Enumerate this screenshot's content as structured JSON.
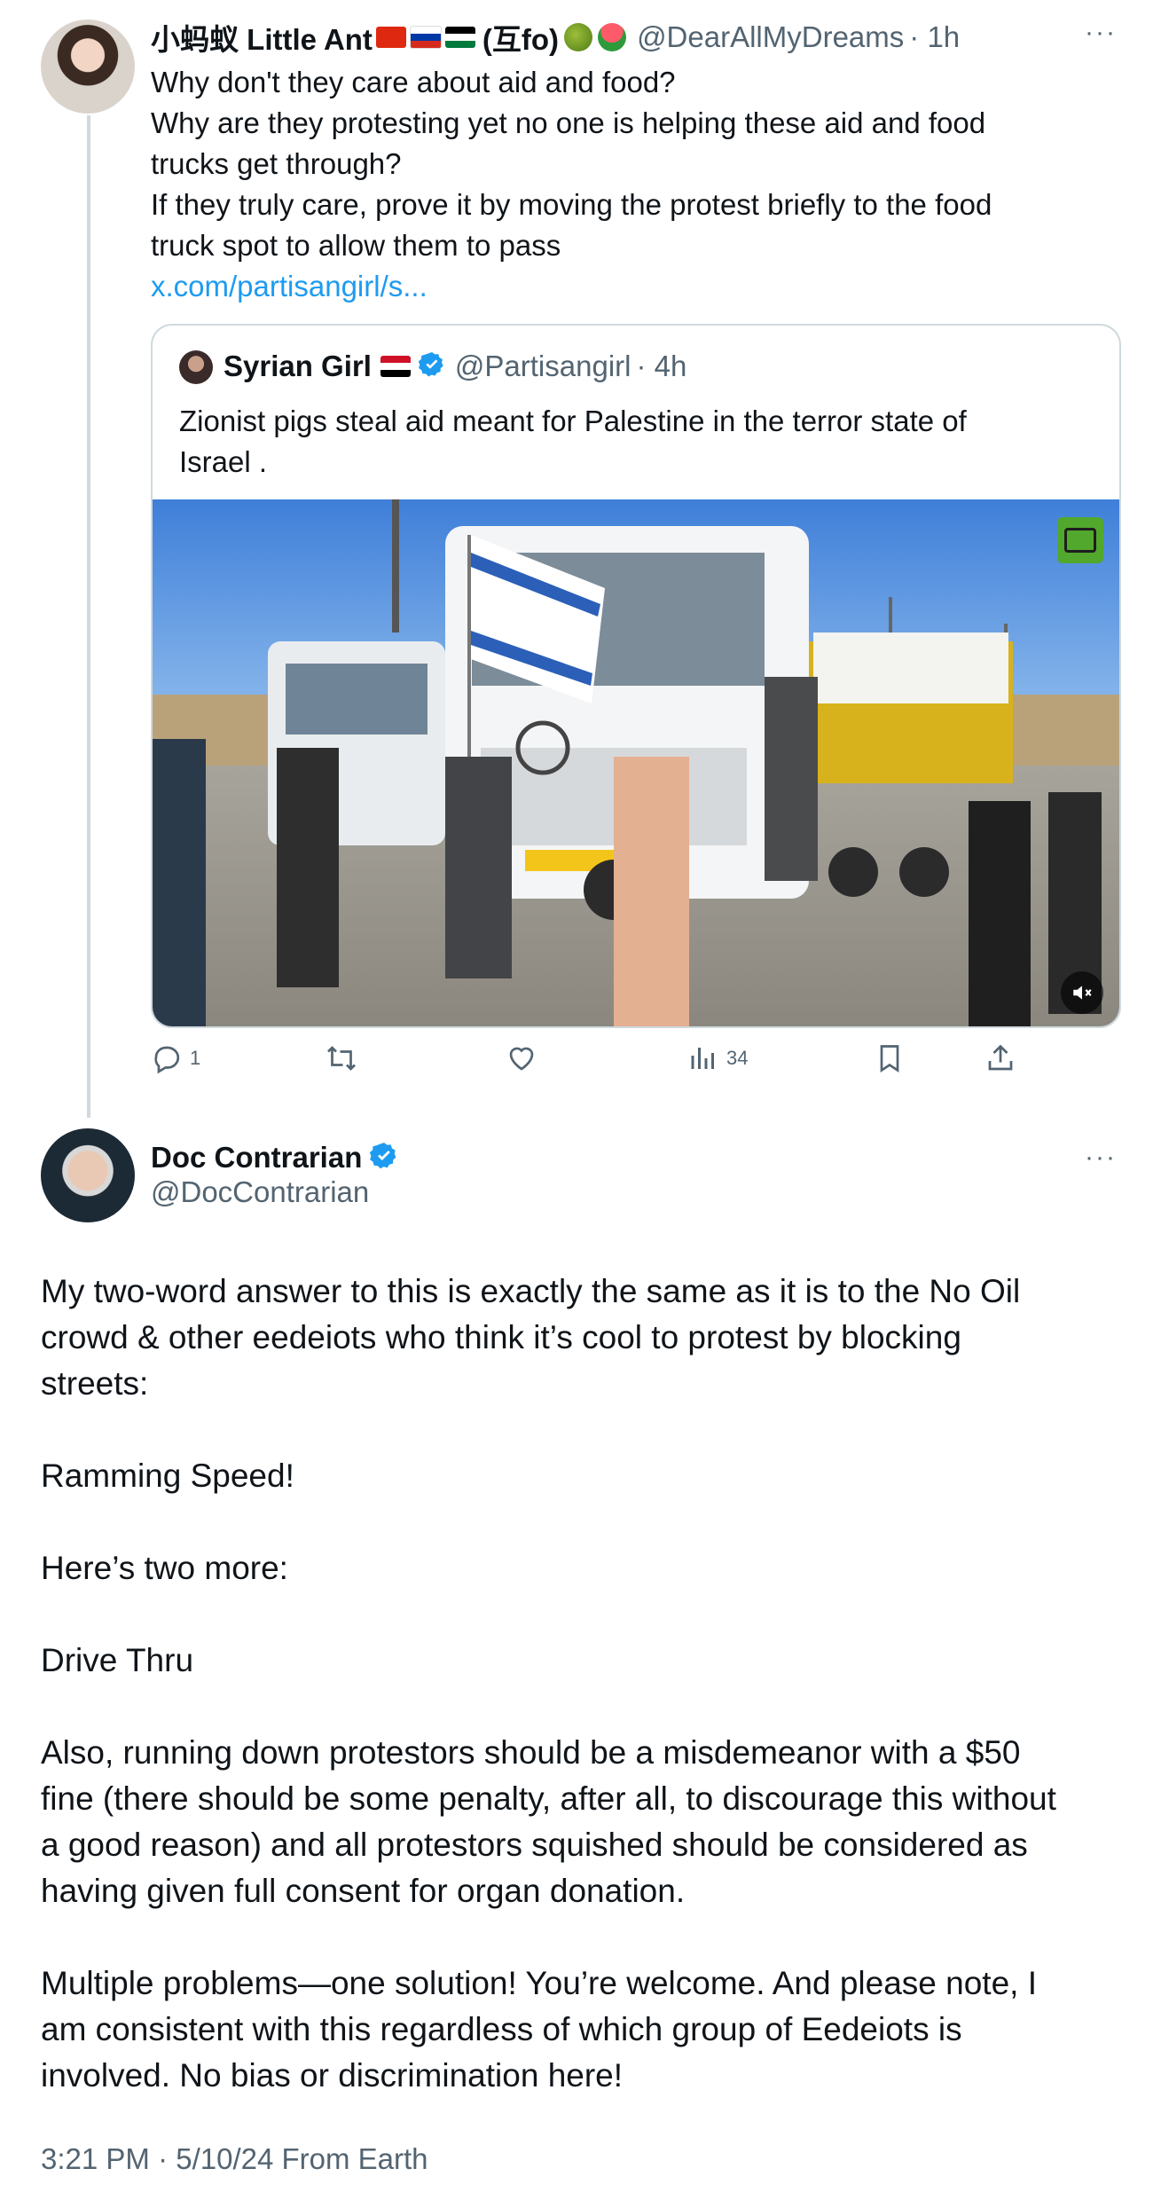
{
  "parent_tweet": {
    "display_name": "小蚂蚁 Little Ant",
    "name_suffix": "(互fo)",
    "handle": "@DearAllMyDreams",
    "time": "· 1h",
    "more": "···",
    "lines": [
      "Why don't they care about aid and food?",
      "Why are they protesting yet no one is helping these aid and food",
      "trucks get through?",
      "If they truly care, prove it by moving the protest briefly to the food",
      "truck spot to allow them to pass"
    ],
    "link": "x.com/partisangirl/s...",
    "quote": {
      "display_name": "Syrian Girl",
      "handle": "@Partisangirl",
      "time": "· 4h",
      "lines": [
        "Zionist pigs steal aid meant for Palestine in the terror state of",
        "Israel ."
      ]
    },
    "actions": {
      "reply_count": "1",
      "retweet_count": "",
      "like_count": "",
      "views_count": "34"
    }
  },
  "main_tweet": {
    "display_name": "Doc Contrarian",
    "handle": "@DocContrarian",
    "more": "···",
    "paragraphs": [
      [
        "My two-word answer to this is exactly the same as it is to the No Oil",
        "crowd & other eedeiots who think it’s cool to protest by blocking",
        "streets:"
      ],
      [
        "Ramming Speed!"
      ],
      [
        "Here’s two more:"
      ],
      [
        "Drive Thru"
      ],
      [
        "Also, running down protestors should be a misdemeanor with a $50",
        "fine (there should be some penalty, after all, to discourage this without",
        "a good reason) and all protestors squished should be considered as",
        "having given full consent for organ donation."
      ],
      [
        "Multiple problems—one solution! You’re welcome. And please note, I",
        "am consistent with this regardless of which group of Eedeiots is",
        "involved. No bias or discrimination here!"
      ]
    ],
    "timestamp": "3:21 PM · 5/10/24 From Earth"
  },
  "colors": {
    "accent": "#1d9bf0",
    "muted": "#536471",
    "border": "#cfd9de",
    "text": "#0f1419"
  }
}
